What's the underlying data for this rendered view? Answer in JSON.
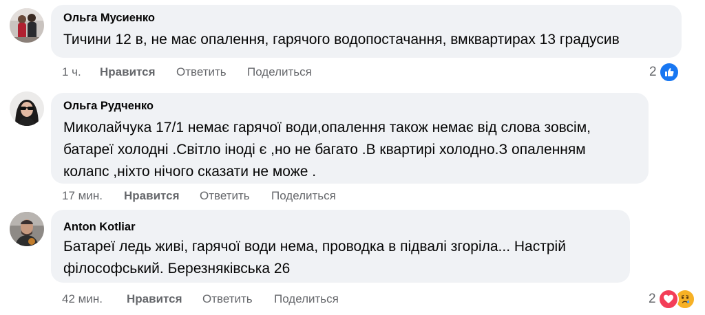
{
  "comments": [
    {
      "author": "Ольга Мусиенко",
      "lines": [
        "Тичини 12 в, не має опалення, гарячого водопостачання, вмквартирах 13 градусив"
      ],
      "time": "1 ч.",
      "like_label": "Нравится",
      "reply_label": "Ответить",
      "share_label": "Поделиться",
      "reaction_count": "2",
      "reactions": [
        "like-icon"
      ]
    },
    {
      "author": "Ольга Рудченко",
      "lines": [
        "Миколайчука 17/1 немає гарячої води,опалення також немає від слова зовсім,",
        "батареї холодні .Світло іноді є ,но не багато .В квартирі холодно.З опаленням",
        "колапс ,ніхто нічого сказати не може ."
      ],
      "time": "17 мин.",
      "like_label": "Нравится",
      "reply_label": "Ответить",
      "share_label": "Поделиться"
    },
    {
      "author": "Anton Kotliar",
      "lines": [
        "Батареї ледь живі, гарячої води нема, проводка в підвалі згоріла... Настрій",
        "філософський. Березняківська 26"
      ],
      "time": "42 мин.",
      "like_label": "Нравится",
      "reply_label": "Ответить",
      "share_label": "Поделиться",
      "reaction_count": "2",
      "reactions": [
        "heart-icon",
        "sad-face-icon"
      ]
    }
  ],
  "colors": {
    "bubble": "#f0f2f5",
    "meta_text": "#65676b",
    "like_blue": "#1877f2",
    "love_red": "#f33e58",
    "sad_yellow": "#f7b125"
  }
}
